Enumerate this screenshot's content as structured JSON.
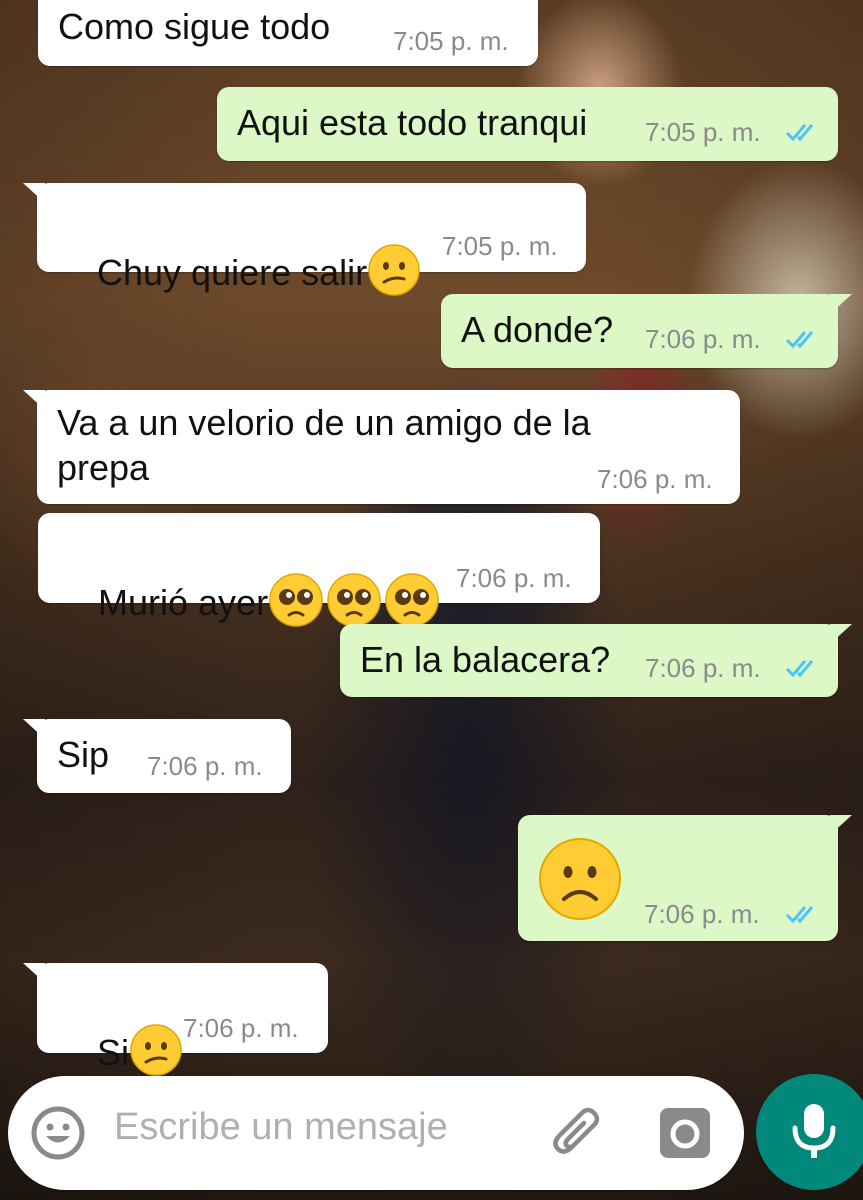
{
  "colors": {
    "incoming_bubble": "#ffffff",
    "outgoing_bubble": "#dcf8c6",
    "timestamp": "#8a8a8a",
    "read_ticks": "#4fc3f7",
    "mic_button": "#00897b",
    "input_icons": "#8a8a8a"
  },
  "messages": [
    {
      "direction": "incoming",
      "text": "Como sigue todo",
      "time": "7:05 p. m."
    },
    {
      "direction": "outgoing",
      "text": "Aqui esta todo tranqui",
      "time": "7:05 p. m.",
      "status": "read"
    },
    {
      "direction": "incoming",
      "text": "Chuy quiere salir",
      "emoji": [
        "confused-face"
      ],
      "time": "7:05 p. m."
    },
    {
      "direction": "outgoing",
      "text": "A donde?",
      "time": "7:06 p. m.",
      "status": "read"
    },
    {
      "direction": "incoming",
      "text": "Va a un velorio de un amigo de la\nprepa",
      "time": "7:06 p. m."
    },
    {
      "direction": "incoming",
      "text": "Murió ayer",
      "emoji": [
        "pleading-face",
        "pleading-face",
        "pleading-face"
      ],
      "time": "7:06 p. m."
    },
    {
      "direction": "outgoing",
      "text": "En la balacera?",
      "time": "7:06 p. m.",
      "status": "read"
    },
    {
      "direction": "incoming",
      "text": "Sip",
      "time": "7:06 p. m."
    },
    {
      "direction": "outgoing",
      "text": "",
      "emoji": [
        "frowning-face"
      ],
      "time": "7:06 p. m.",
      "status": "read"
    },
    {
      "direction": "incoming",
      "text": "Si",
      "emoji": [
        "confused-face"
      ],
      "time": "7:06 p. m."
    }
  ],
  "composer": {
    "placeholder": "Escribe un mensaje",
    "icons": [
      "emoji-icon",
      "attach-icon",
      "camera-icon",
      "mic-icon"
    ]
  }
}
